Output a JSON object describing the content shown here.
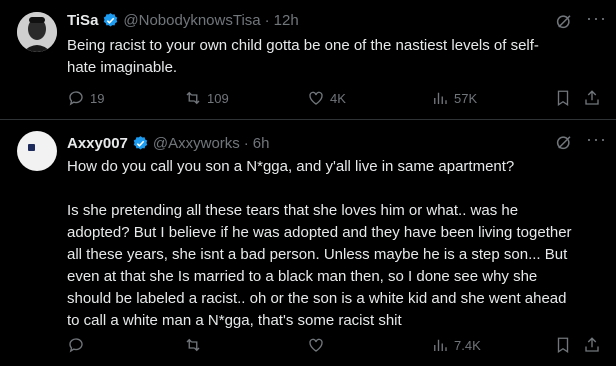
{
  "tweets": [
    {
      "name": "TiSa",
      "handle": "@NobodyknowsTisa",
      "dot": "·",
      "time": "12h",
      "text": "Being racist to your own child gotta be one of the nastiest levels of self-\nhate imaginable.",
      "replies": "19",
      "retweets": "109",
      "likes": "4K",
      "views": "57K"
    },
    {
      "name": "Axxy007",
      "handle": "@Axxyworks",
      "dot": "·",
      "time": "6h",
      "text": "How do you call you son a N*gga, and y'all live in same apartment?\n\nIs she pretending all these tears that she loves him or what.. was he\nadopted? But I believe if he was adopted and they have been living together\nall these years, she isnt a bad person. Unless maybe he is a step son... But\neven at that she Is married to a black man then, so I done see why she\nshould be labeled a racist.. oh or the son is a white kid and she went ahead\nto call a white man a N*gga, that's some racist shit",
      "replies": "",
      "retweets": "",
      "likes": "",
      "views": "7.4K"
    }
  ],
  "more_label": "···",
  "colors": {
    "background": "#000000",
    "text": "#e7e9ea",
    "muted": "#71767b",
    "verified": "#1d9bf0",
    "divider": "#2f3336"
  },
  "icons": [
    "verified-badge-icon",
    "grok-icon",
    "more-icon",
    "reply-icon",
    "retweet-icon",
    "like-icon",
    "views-icon",
    "bookmark-icon",
    "share-icon"
  ]
}
